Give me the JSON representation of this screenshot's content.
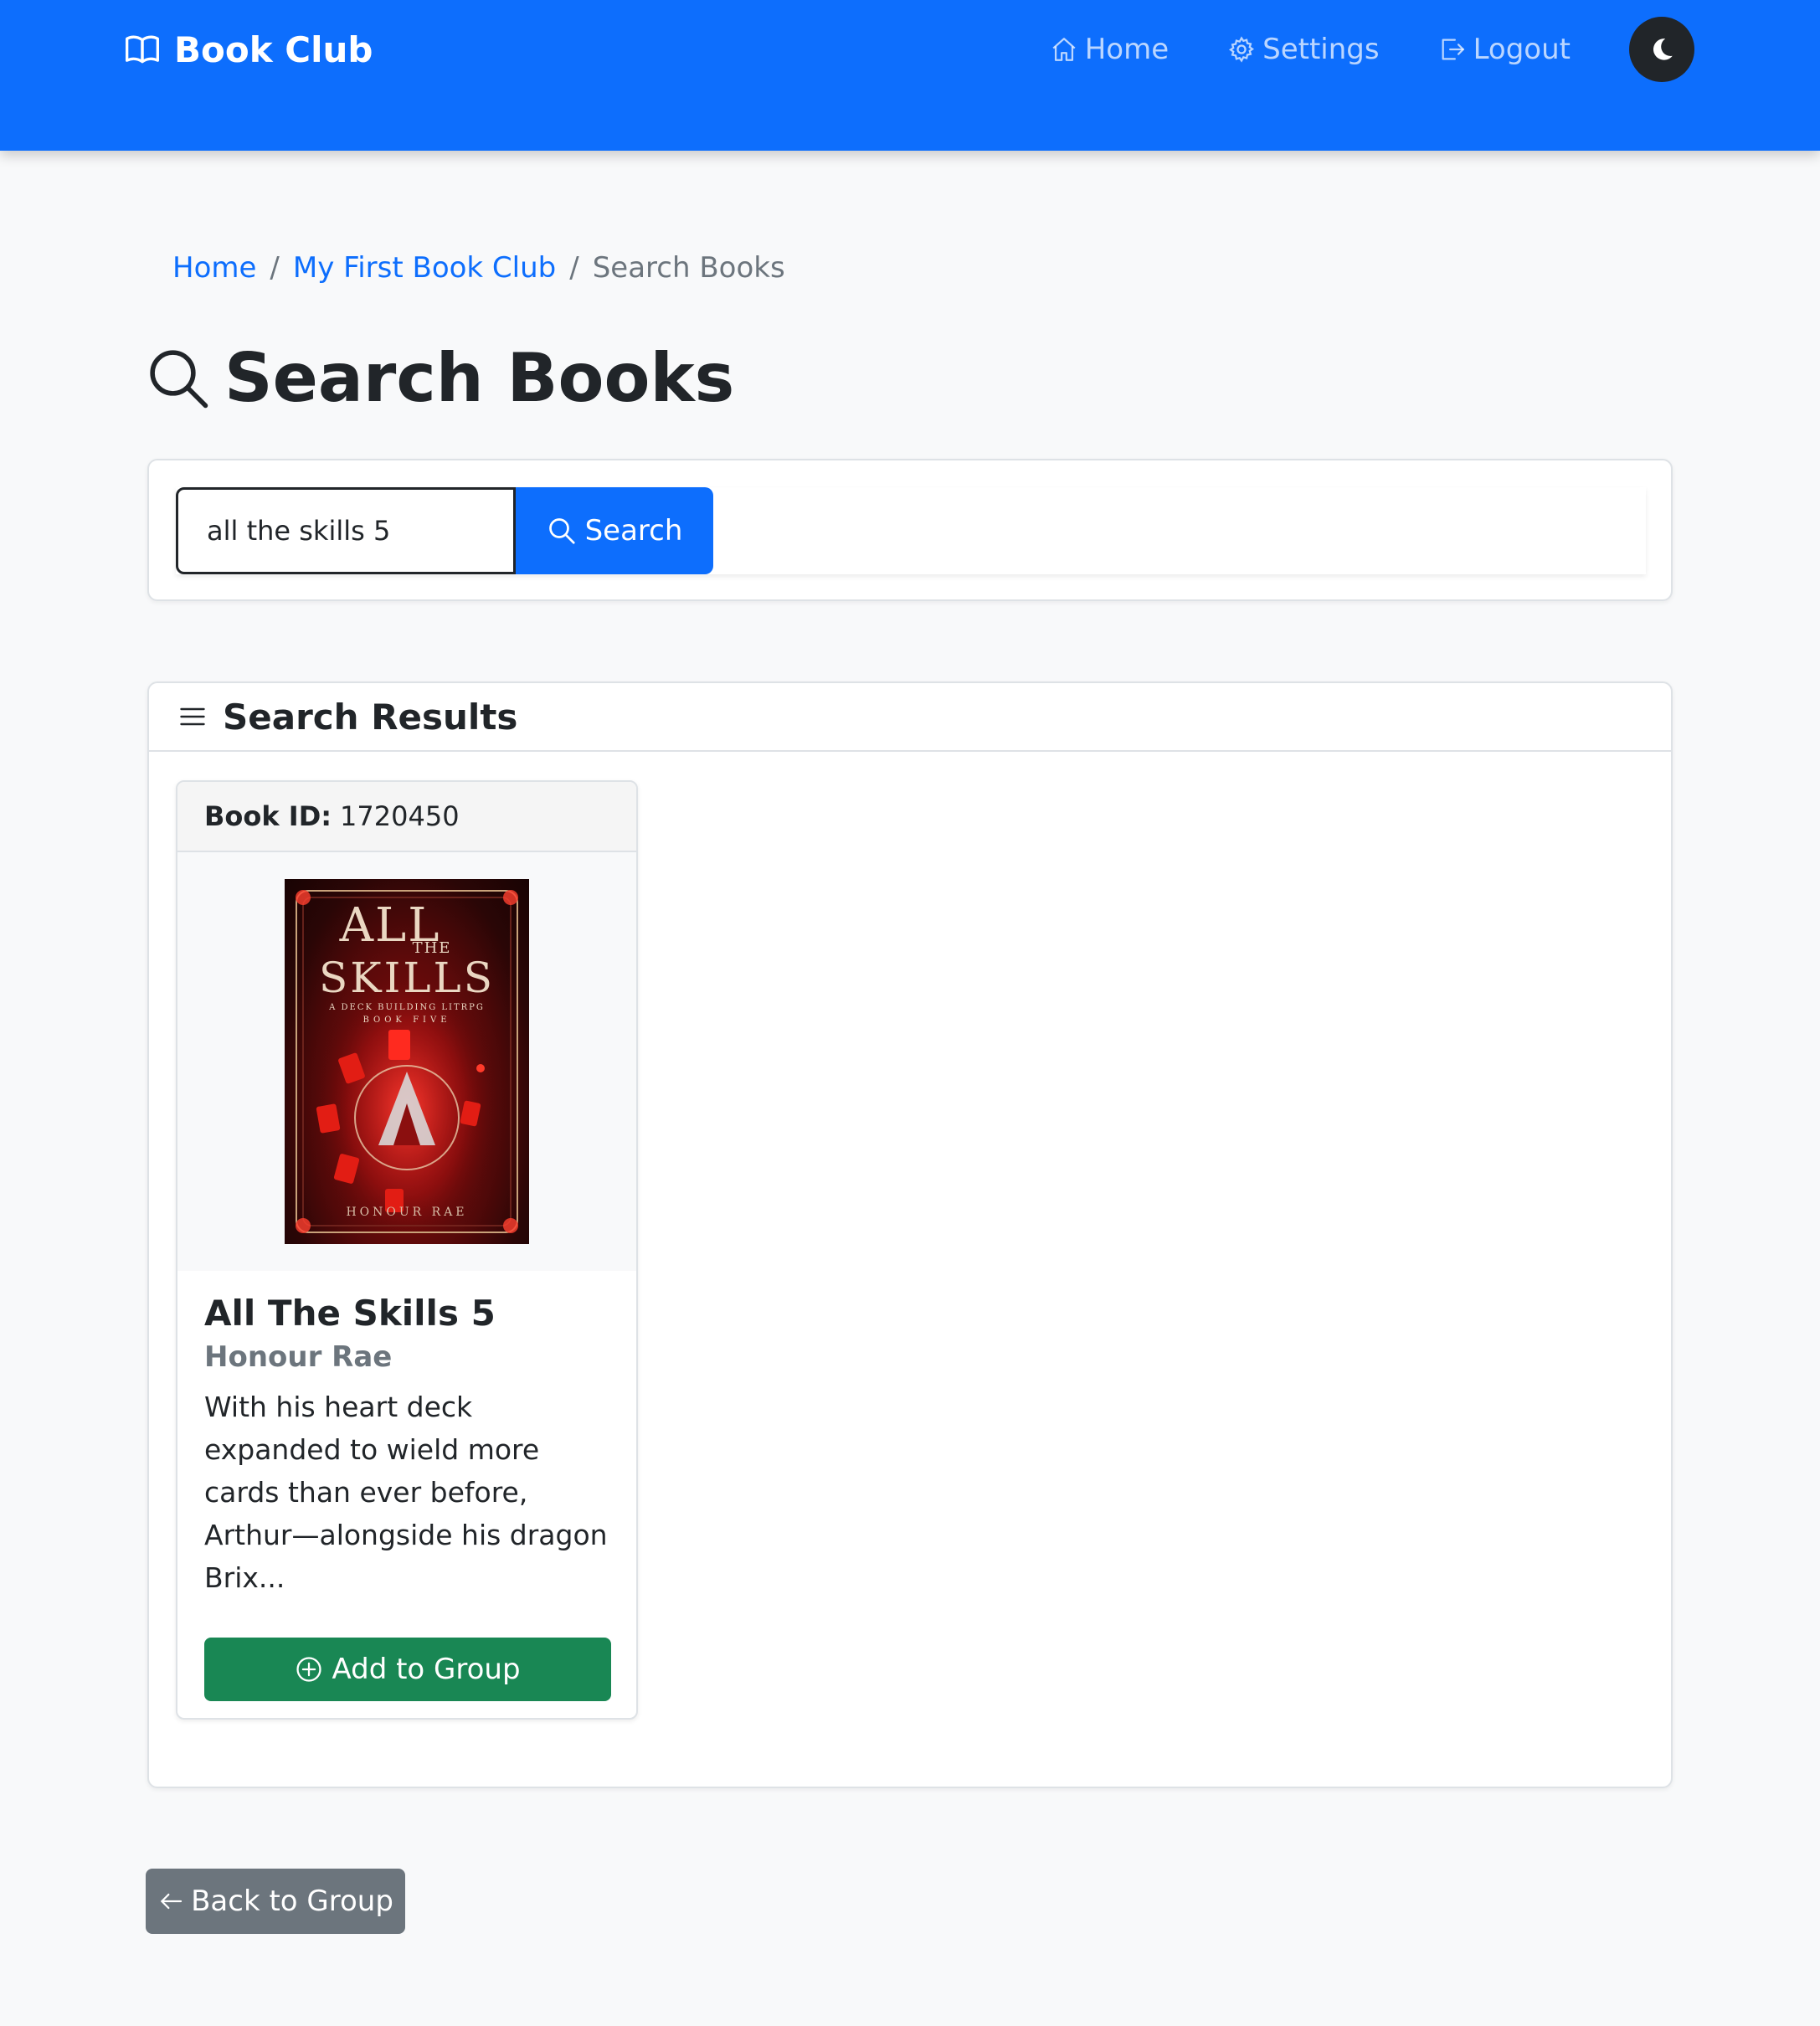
{
  "navbar": {
    "brand": "Book Club",
    "brand_icon": "book-open-icon",
    "links": [
      {
        "label": "Home",
        "icon": "house-icon"
      },
      {
        "label": "Settings",
        "icon": "gear-icon"
      },
      {
        "label": "Logout",
        "icon": "logout-icon"
      }
    ],
    "theme_toggle_icon": "moon-icon",
    "color": "#0d6efd"
  },
  "breadcrumb": {
    "items": [
      "Home",
      "My First Book Club"
    ],
    "current": "Search Books",
    "separator": "/"
  },
  "page": {
    "title": "Search Books",
    "title_icon": "search-icon"
  },
  "search": {
    "value": "all the skills 5",
    "button_label": "Search",
    "button_color": "#0d6efd"
  },
  "results": {
    "header": "Search Results",
    "header_icon": "list-icon",
    "books": [
      {
        "id_label": "Book ID:",
        "id": "1720450",
        "cover": {
          "title_line1": "ALL",
          "title_line2": "THE",
          "title_line3": "SKILLS",
          "subtitle": "A DECK BUILDING LITRPG",
          "book_number": "BOOK FIVE",
          "author": "HONOUR RAE"
        },
        "title": "All The Skills 5",
        "author": "Honour Rae",
        "description": "With his heart deck expanded to wield more cards than ever before, Arthur—alongside his dragon Brix...",
        "add_button_label": "Add to Group",
        "add_button_color": "#198754"
      }
    ]
  },
  "back_button": {
    "label": "Back to Group",
    "color": "#6c757d"
  }
}
